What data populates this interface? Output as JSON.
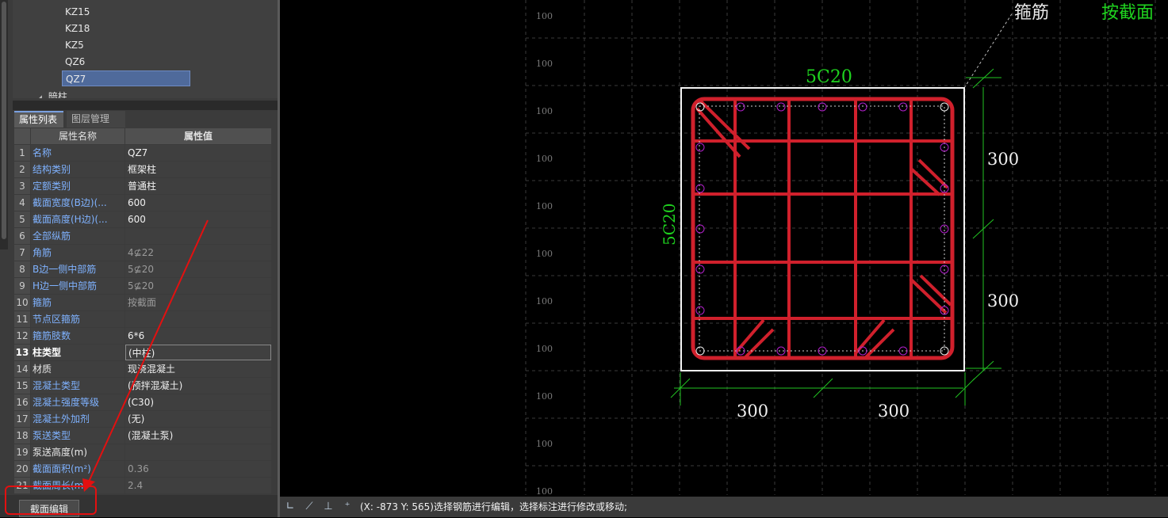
{
  "tree": {
    "items": [
      "KZ15",
      "KZ18",
      "KZ5",
      "QZ6",
      "QZ7"
    ],
    "selected_index": 4,
    "group_label": "暗柱"
  },
  "tabs": {
    "properties": "属性列表",
    "layers": "图层管理"
  },
  "table": {
    "header_name": "属性名称",
    "header_value": "属性值",
    "rows": [
      {
        "num": "1",
        "name": "名称",
        "value": "QZ7"
      },
      {
        "num": "2",
        "name": "结构类别",
        "value": "框架柱"
      },
      {
        "num": "3",
        "name": "定额类别",
        "value": "普通柱"
      },
      {
        "num": "4",
        "name": "截面宽度(B边)(...",
        "value": "600"
      },
      {
        "num": "5",
        "name": "截面高度(H边)(...",
        "value": "600"
      },
      {
        "num": "6",
        "name": "全部纵筋",
        "value": ""
      },
      {
        "num": "7",
        "name": "角筋",
        "value": "4⊈22"
      },
      {
        "num": "8",
        "name": "B边一侧中部筋",
        "value": "5⊈20"
      },
      {
        "num": "9",
        "name": "H边一侧中部筋",
        "value": "5⊈20"
      },
      {
        "num": "10",
        "name": "箍筋",
        "value": "按截面"
      },
      {
        "num": "11",
        "name": "节点区箍筋",
        "value": ""
      },
      {
        "num": "12",
        "name": "箍筋肢数",
        "value": "6*6"
      },
      {
        "num": "13",
        "name": "柱类型",
        "value": "(中柱)"
      },
      {
        "num": "14",
        "name": "材质",
        "value": "现浇混凝土"
      },
      {
        "num": "15",
        "name": "混凝土类型",
        "value": "(预拌混凝土)"
      },
      {
        "num": "16",
        "name": "混凝土强度等级",
        "value": "(C30)"
      },
      {
        "num": "17",
        "name": "混凝土外加剂",
        "value": "(无)"
      },
      {
        "num": "18",
        "name": "泵送类型",
        "value": "(混凝土泵)"
      },
      {
        "num": "19",
        "name": "泵送高度(m)",
        "value": ""
      },
      {
        "num": "20",
        "name": "截面面积(m²)",
        "value": "0.36"
      },
      {
        "num": "21",
        "name": "截面周长(m)",
        "value": "2.4"
      }
    ]
  },
  "bottom": {
    "section_edit_label": "截面编辑"
  },
  "drawing": {
    "grid_label": "100",
    "top_rebar_label": "5C20",
    "left_rebar_label": "5C20",
    "stirrup_label": "箍筋",
    "stirrup_value": "按截面",
    "dim_right_top": "300",
    "dim_right_bottom": "300",
    "dim_bottom_left": "300",
    "dim_bottom_right": "300"
  },
  "status": {
    "text": "(X: -873 Y: 565)选择钢筋进行编辑，选择标注进行修改或移动;",
    "icons": [
      "ortho-icon",
      "polar-icon",
      "perpendicular-icon",
      "dynamic-input-icon"
    ]
  },
  "colors": {
    "rebar_red": "#d0202c",
    "dim_green": "#22c322",
    "label_green": "#1fd31f",
    "selected_blue": "#4f6a9b",
    "annotation_red": "#e31010"
  }
}
